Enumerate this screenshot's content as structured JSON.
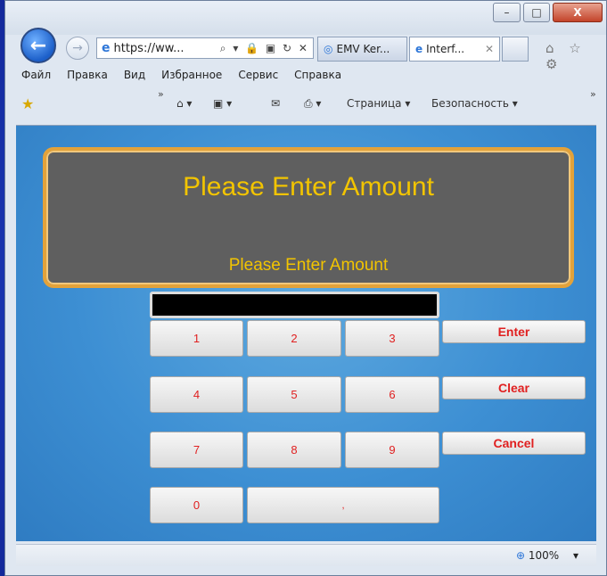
{
  "window": {
    "controls": {
      "minimize": "–",
      "maximize": "□",
      "close": "X"
    }
  },
  "nav": {
    "back_icon": "←",
    "forward_icon": "→",
    "address": "https://ww...",
    "address_tools": "⌕ ▾ 🔒 ▣ ↻ ✕",
    "tabs": [
      {
        "label": "EMV Ker...",
        "icon": "ie-tab-icon"
      },
      {
        "label": "Interf...",
        "icon": "ie-tab-icon",
        "close": "✕"
      }
    ],
    "right_icons": "⌂ ☆ ⚙"
  },
  "menubar": {
    "items": [
      "Файл",
      "Правка",
      "Вид",
      "Избранное",
      "Сервис",
      "Справка"
    ]
  },
  "cmdbar": {
    "chevron": "»",
    "home": "⌂ ▾",
    "feeds": "▣ ▾",
    "mail": "✉",
    "print": "⎙ ▾",
    "page": "Страница ▾",
    "safety": "Безопасность ▾"
  },
  "app": {
    "title": "Please Enter Amount",
    "subtitle": "Please Enter Amount",
    "display_value": "",
    "keys": [
      "1",
      "2",
      "3",
      "4",
      "5",
      "6",
      "7",
      "8",
      "9",
      "0",
      ","
    ],
    "actions": {
      "enter": "Enter",
      "clear": "Clear",
      "cancel": "Cancel"
    }
  },
  "status": {
    "zoom": "100%",
    "zoom_arrow": "▾"
  },
  "colors": {
    "accent_text": "#f2c400",
    "key_text": "#e02020",
    "panel_border": "#e3a23a",
    "panel_bg": "#5f5f5f"
  }
}
